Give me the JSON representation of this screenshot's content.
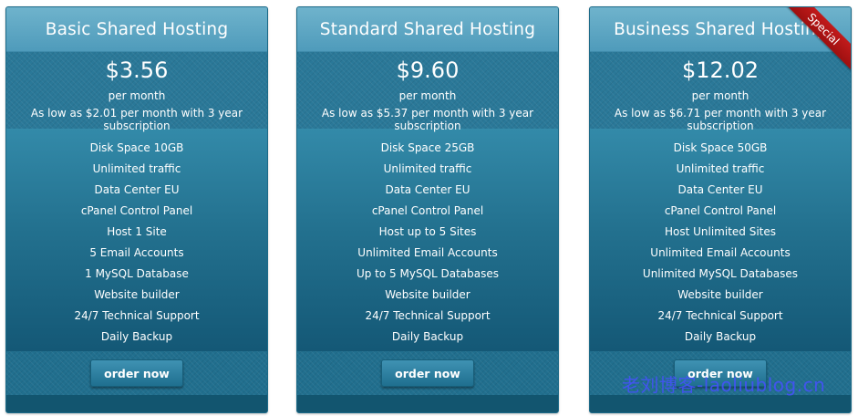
{
  "plans": [
    {
      "title": "Basic Shared Hosting",
      "price": "$3.56",
      "period": "per month",
      "as_low": "As low as $2.01 per month with 3 year subscription",
      "features": [
        "Disk Space 10GB",
        "Unlimited traffic",
        "Data Center EU",
        "cPanel Control Panel",
        "Host 1 Site",
        "5 Email Accounts",
        "1 MySQL Database",
        "Website builder",
        "24/7 Technical Support",
        "Daily Backup"
      ],
      "button": "order now"
    },
    {
      "title": "Standard Shared Hosting",
      "price": "$9.60",
      "period": "per month",
      "as_low": "As low as $5.37 per month with 3 year subscription",
      "features": [
        "Disk Space 25GB",
        "Unlimited traffic",
        "Data Center EU",
        "cPanel Control Panel",
        "Host up to 5 Sites",
        "Unlimited Email Accounts",
        "Up to 5 MySQL Databases",
        "Website builder",
        "24/7 Technical Support",
        "Daily Backup"
      ],
      "button": "order now"
    },
    {
      "title": "Business Shared Hosting",
      "price": "$12.02",
      "period": "per month",
      "as_low": "As low as $6.71 per month with 3 year subscription",
      "features": [
        "Disk Space 50GB",
        "Unlimited traffic",
        "Data Center EU",
        "cPanel Control Panel",
        "Host Unlimited Sites",
        "Unlimited Email Accounts",
        "Unlimited MySQL Databases",
        "Website builder",
        "24/7 Technical Support",
        "Daily Backup"
      ],
      "button": "order now",
      "ribbon": "Special"
    }
  ],
  "watermark": "老刘博客-laoliublog.cn",
  "colors": {
    "header": "#5aa5c3",
    "body": "#1d6c8e",
    "ribbon": "#b81616",
    "watermark": "#4650ff"
  }
}
